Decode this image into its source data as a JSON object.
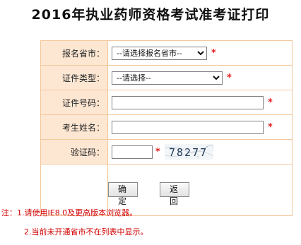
{
  "page": {
    "title": "2016年执业药师资格考试准考证打印"
  },
  "form": {
    "province": {
      "label": "报名省市：",
      "selected": "--请选择报名省市--",
      "required_mark": "*"
    },
    "cert_type": {
      "label": "证件类型：",
      "selected": "--请选择--",
      "required_mark": "*"
    },
    "cert_no": {
      "label": "证件号码：",
      "value": "",
      "required_mark": "*"
    },
    "name": {
      "label": "考生姓名：",
      "value": "",
      "required_mark": "*"
    },
    "captcha": {
      "label": "验证码：",
      "value": "",
      "required_mark": "*",
      "image_text": "78277"
    }
  },
  "buttons": {
    "ok_label": "确 定",
    "back_label": "返 回"
  },
  "notes": {
    "line1": "注：1.请使用IE8.0及更高版本浏览器。",
    "line2": "2.当前未开通省市不在列表中显示。"
  },
  "colors": {
    "label_bg": "#fde7d3",
    "border": "#f4c79b",
    "required": "#e02020",
    "note_text": "#d20000"
  }
}
